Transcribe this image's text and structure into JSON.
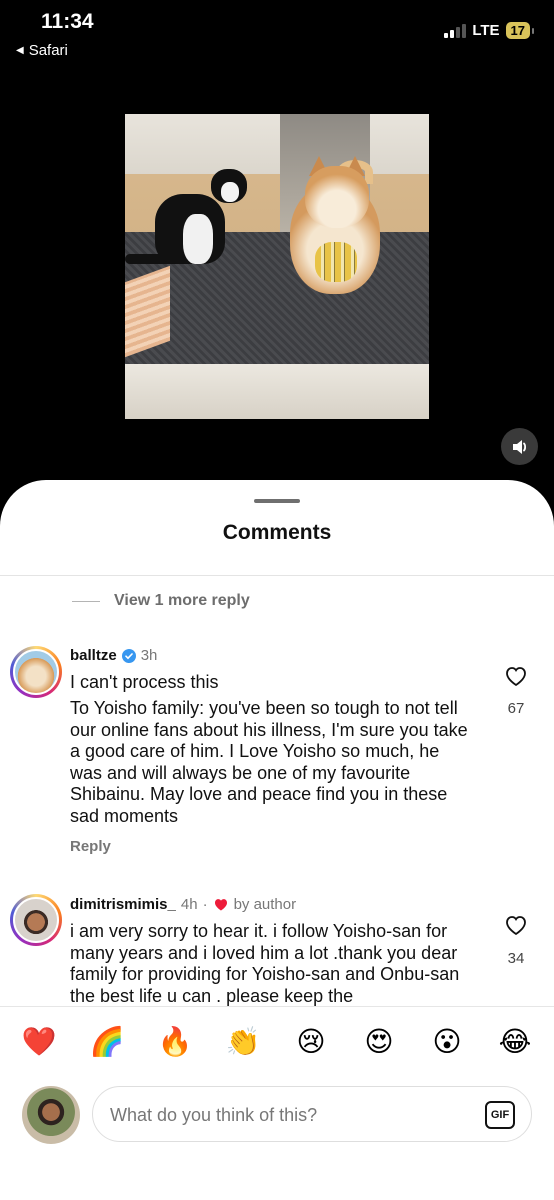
{
  "status_bar": {
    "time": "11:34",
    "back_app": "Safari",
    "network": "LTE",
    "battery": "17"
  },
  "sheet": {
    "title": "Comments",
    "view_more_replies": "View 1 more reply"
  },
  "comments": [
    {
      "username": "balltze",
      "verified": true,
      "time": "3h",
      "lines": [
        "I can't process this",
        "To Yoisho family: you've been so tough to not tell our online fans about his illness, I'm sure you take a good care of him. I Love Yoisho so much, he was and will always be one of my favourite Shibainu. May love and peace find you in these sad moments"
      ],
      "reply_label": "Reply",
      "likes": "67"
    },
    {
      "username": "dimitrismimis_",
      "time": "4h",
      "liked_by_author": "by author",
      "separator": "·",
      "body": "i am very sorry to hear it. i follow Yoisho-san for many years and i loved him a lot .thank you dear family for providing for Yoisho-san and Onbu-san the best life u can . please keep the",
      "likes": "34"
    }
  ],
  "reactions": [
    "❤️",
    "🌈",
    "🔥",
    "👏",
    "😢",
    "😍",
    "😮",
    "😂"
  ],
  "compose": {
    "placeholder": "What do you think of this?",
    "gif_label": "GIF"
  },
  "colors": {
    "sheet_bg": "#ffffff",
    "verified": "#3797f0",
    "heart_red": "#ed1c3a",
    "muted_text": "#777777"
  },
  "icons": [
    "speaker-icon",
    "verified-badge-icon",
    "heart-outline-icon",
    "heart-filled-icon",
    "gif-icon",
    "back-triangle-icon",
    "signal-icon",
    "battery-icon"
  ]
}
